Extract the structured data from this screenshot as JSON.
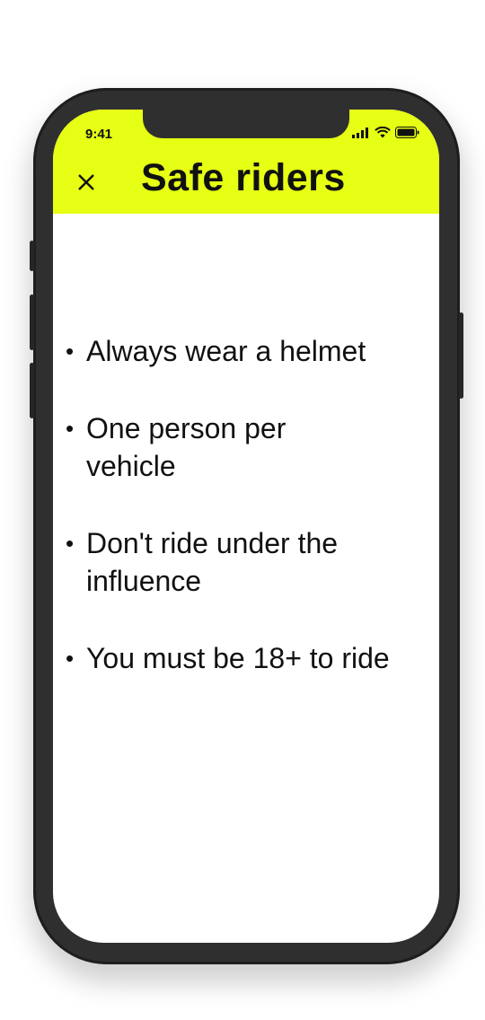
{
  "status_bar": {
    "time": "9:41"
  },
  "header": {
    "title": "Safe riders",
    "close_icon": "close-icon"
  },
  "rules": [
    "Always wear a helmet",
    "One person per vehicle",
    "Don't ride under the influence",
    "You must be 18+ to ride"
  ],
  "colors": {
    "header_background": "#e6ff14",
    "text": "#111111",
    "device_frame": "#2f2f2f",
    "screen_background": "#ffffff"
  }
}
